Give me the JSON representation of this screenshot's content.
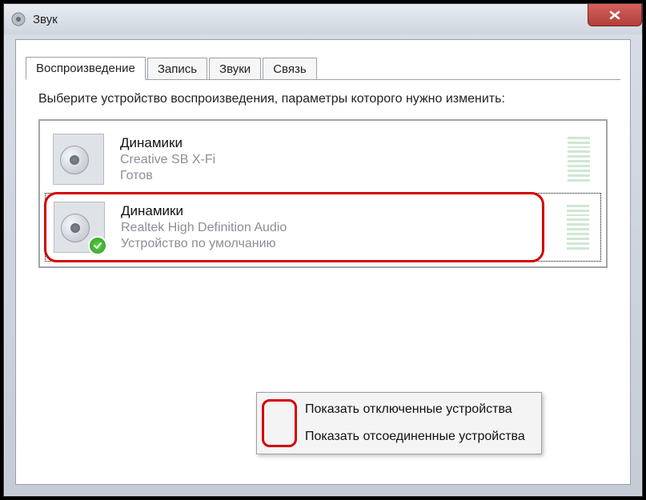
{
  "window": {
    "title": "Звук"
  },
  "tabs": [
    "Воспроизведение",
    "Запись",
    "Звуки",
    "Связь"
  ],
  "activeTab": 0,
  "instruction": "Выберите устройство воспроизведения, параметры которого нужно изменить:",
  "devices": [
    {
      "name": "Динамики",
      "description": "Creative SB X-Fi",
      "status": "Готов",
      "default": false,
      "selected": false
    },
    {
      "name": "Динамики",
      "description": "Realtek High Definition Audio",
      "status": "Устройство по умолчанию",
      "default": true,
      "selected": true
    }
  ],
  "contextMenu": {
    "items": [
      "Показать отключенные устройства",
      "Показать отсоединенные устройства"
    ]
  }
}
